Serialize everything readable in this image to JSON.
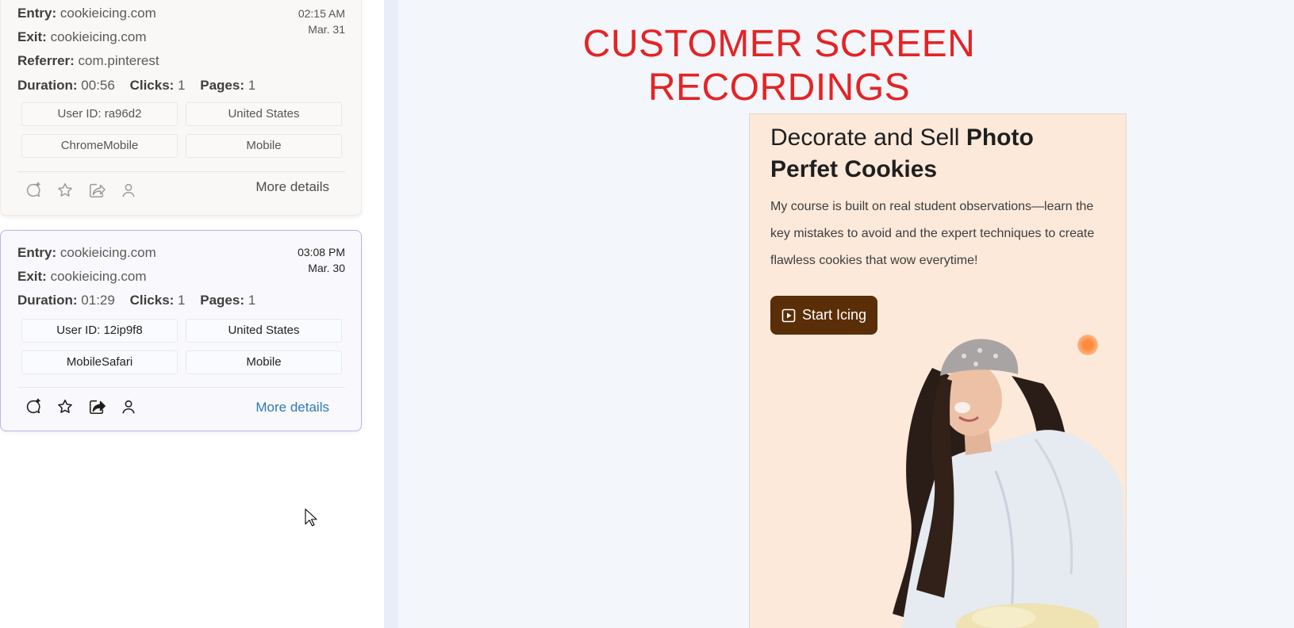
{
  "sessions": [
    {
      "entry_label": "Entry:",
      "entry": "cookieicing.com",
      "exit_label": "Exit:",
      "exit": "cookieicing.com",
      "referrer_label": "Referrer:",
      "referrer": "com.pinterest",
      "time": "02:15 AM",
      "date": "Mar. 31",
      "duration_label": "Duration:",
      "duration": "00:56",
      "clicks_label": "Clicks:",
      "clicks": "1",
      "pages_label": "Pages:",
      "pages": "1",
      "user_id": "User ID: ra96d2",
      "country": "United States",
      "browser": "ChromeMobile",
      "device": "Mobile",
      "more_details": "More details"
    },
    {
      "entry_label": "Entry:",
      "entry": "cookieicing.com",
      "exit_label": "Exit:",
      "exit": "cookieicing.com",
      "time": "03:08 PM",
      "date": "Mar. 30",
      "duration_label": "Duration:",
      "duration": "01:29",
      "clicks_label": "Clicks:",
      "clicks": "1",
      "pages_label": "Pages:",
      "pages": "1",
      "user_id": "User ID: 12ip9f8",
      "country": "United States",
      "browser": "MobileSafari",
      "device": "Mobile",
      "more_details": "More details"
    }
  ],
  "icons": [
    "ai-chat-icon",
    "star-icon",
    "share-icon",
    "user-icon"
  ],
  "recording": {
    "headline_line1": "CUSTOMER SCREEN",
    "headline_line2": "RECORDINGS",
    "promo_title_plain": "Decorate and Sell ",
    "promo_title_bold": "Photo Perfet Cookies",
    "promo_desc": "My course is built on real student observations—learn the key mistakes to avoid and the expert techniques to create flawless cookies that wow everytime!",
    "cta_label": "Start Icing"
  },
  "colors": {
    "headline": "#e52324",
    "cta_bg": "#5a2e06",
    "promo_bg": "#fce9da",
    "link": "#2b7ab6",
    "selected_border": "#b9b2ea"
  }
}
